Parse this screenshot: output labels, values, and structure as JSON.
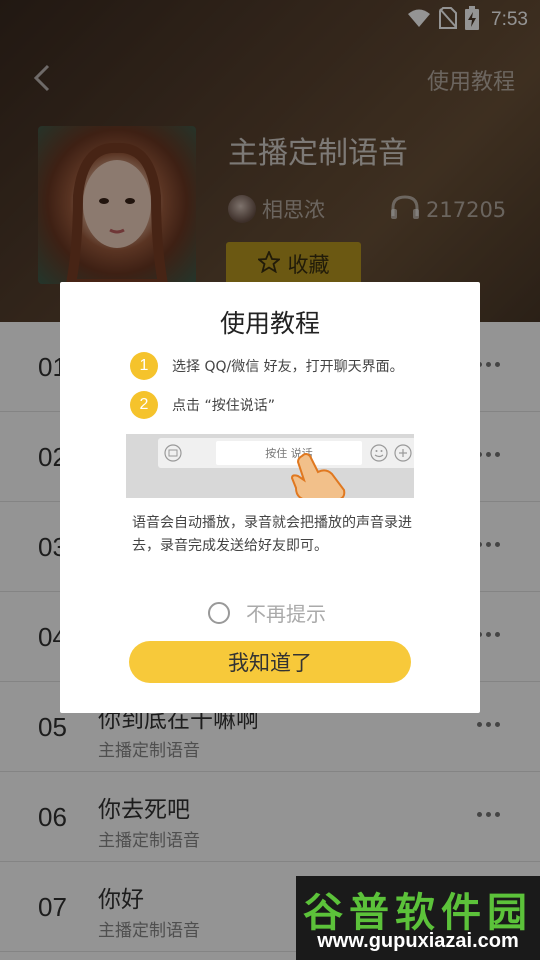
{
  "status_bar": {
    "time": "7:53"
  },
  "header": {
    "tutorial_link": "使用教程",
    "title": "主播定制语音",
    "author": "相思浓",
    "play_count": "217205",
    "favorite_label": "收藏"
  },
  "tracks": [
    {
      "num": "01",
      "title": "",
      "sub": ""
    },
    {
      "num": "02",
      "title": "",
      "sub": ""
    },
    {
      "num": "03",
      "title": "",
      "sub": ""
    },
    {
      "num": "04",
      "title": "",
      "sub": ""
    },
    {
      "num": "05",
      "title": "你到底在干嘛啊",
      "sub": "主播定制语音"
    },
    {
      "num": "06",
      "title": "你去死吧",
      "sub": "主播定制语音"
    },
    {
      "num": "07",
      "title": "你好",
      "sub": "主播定制语音"
    }
  ],
  "dialog": {
    "title": "使用教程",
    "steps": [
      {
        "num": "1",
        "text": "选择 QQ/微信 好友，打开聊天界面。"
      },
      {
        "num": "2",
        "text": "点击 “按住说话”"
      }
    ],
    "illustration_input": "按住 说话",
    "description": "语音会自动播放，录音就会把播放的声音录进去，录音完成发送给好友即可。",
    "no_remind": "不再提示",
    "confirm": "我知道了"
  },
  "watermark": {
    "title": "谷普软件园",
    "url": "www.gupuxiazai.com"
  },
  "colors": {
    "accent": "#f7c93a",
    "fav_button": "#b89820",
    "watermark_green": "#5cc23a"
  }
}
